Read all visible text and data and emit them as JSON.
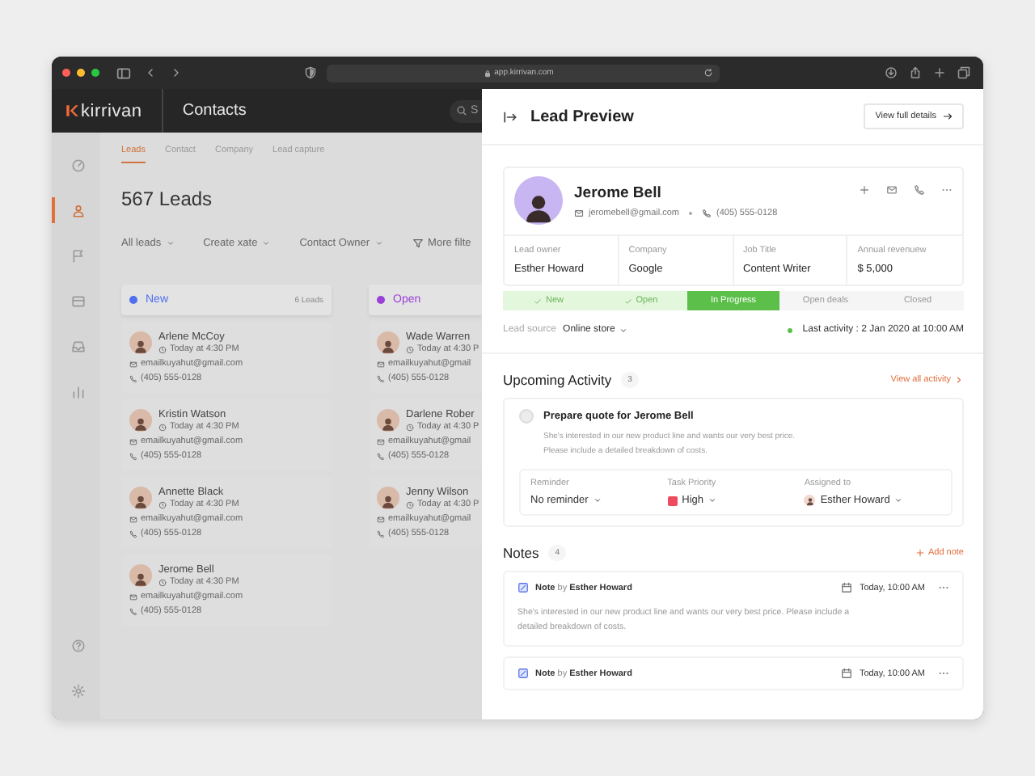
{
  "browser": {
    "url": "app.kirrivan.com"
  },
  "app_header": {
    "logo": "kirrivan",
    "section": "Contacts",
    "search_placeholder": "S"
  },
  "sidebar": {
    "items": [
      {
        "selected": false
      },
      {
        "selected": true
      },
      {
        "selected": false
      },
      {
        "selected": false
      },
      {
        "selected": false
      },
      {
        "selected": false
      }
    ],
    "bottom_items": [
      {
        "selected": false
      },
      {
        "selected": false
      }
    ]
  },
  "tabs": [
    {
      "label": "Leads",
      "selected": true
    },
    {
      "label": "Contact",
      "selected": false
    },
    {
      "label": "Company",
      "selected": false
    },
    {
      "label": "Lead capture",
      "selected": false
    }
  ],
  "heading": "567 Leads",
  "filters": [
    {
      "kind": "dropdown",
      "label": "All leads"
    },
    {
      "kind": "dropdown",
      "label": "Create xate"
    },
    {
      "kind": "dropdown",
      "label": "Contact Owner"
    },
    {
      "kind": "filter",
      "label": "More filte"
    }
  ],
  "columns": [
    {
      "title": "New",
      "color": "#4f6ef0",
      "count": "6 Leads",
      "cards": [
        {
          "name": "Arlene McCoy",
          "time": "Today at 4:30 PM",
          "email": "emailkuyahut@gmail.com",
          "phone": "(405) 555-0128"
        },
        {
          "name": "Kristin Watson",
          "time": "Today at 4:30 PM",
          "email": "emailkuyahut@gmail.com",
          "phone": "(405) 555-0128"
        },
        {
          "name": "Annette Black",
          "time": "Today at 4:30 PM",
          "email": "emailkuyahut@gmail.com",
          "phone": "(405) 555-0128"
        },
        {
          "name": "Jerome Bell",
          "time": "Today at 4:30 PM",
          "email": "emailkuyahut@gmail.com",
          "phone": "(405) 555-0128"
        }
      ]
    },
    {
      "title": "Open",
      "color": "#9a3fd8",
      "cards": [
        {
          "name": "Wade Warren",
          "time": "Today at 4:30 P",
          "email": "emailkuyahut@gmail",
          "phone": "(405) 555-0128"
        },
        {
          "name": "Darlene Rober",
          "time": "Today at 4:30 P",
          "email": "emailkuyahut@gmail",
          "phone": "(405) 555-0128"
        },
        {
          "name": "Jenny Wilson",
          "time": "Today at 4:30 P",
          "email": "emailkuyahut@gmail",
          "phone": "(405) 555-0128"
        }
      ]
    }
  ],
  "lead_preview": {
    "title": "Lead Preview",
    "details_button": "View full details",
    "lead": {
      "name": "Jerome Bell",
      "email": "jeromebell@gmail.com",
      "phone": "(405) 555-0128"
    },
    "info": [
      {
        "label": "Lead owner",
        "value": "Esther Howard"
      },
      {
        "label": "Company",
        "value": "Google"
      },
      {
        "label": "Job Title",
        "value": "Content Writer"
      },
      {
        "label": "Annual revenuew",
        "value": "$ 5,000"
      }
    ],
    "stages": [
      {
        "label": "New",
        "completed": true,
        "selected": false
      },
      {
        "label": "Open",
        "completed": true,
        "selected": false
      },
      {
        "label": "In Progress",
        "completed": false,
        "selected": true
      },
      {
        "label": "Open deals",
        "completed": false,
        "selected": false
      },
      {
        "label": "Closed",
        "completed": false,
        "selected": false
      }
    ],
    "lead_source": {
      "label": "Lead source",
      "value": "Online store"
    },
    "last_activity": "Last activity : 2 Jan 2020 at 10:00 AM",
    "upcoming": {
      "title": "Upcoming Activity",
      "count": "3",
      "link": "View all activity",
      "activity": {
        "title": "Prepare quote for Jerome Bell",
        "checked": false,
        "description": "She's interested in our new product line and wants our very best price.\nPlease include a detailed breakdown of costs.",
        "fields": [
          {
            "kind": "plain",
            "label": "Reminder",
            "value": "No reminder"
          },
          {
            "kind": "priority",
            "label": "Task Priority",
            "value": "High",
            "color": "#ee4b5f"
          },
          {
            "kind": "person",
            "label": "Assigned to",
            "value": "Esther Howard"
          }
        ]
      }
    },
    "notes": {
      "title": "Notes",
      "count": "4",
      "add": "Add note",
      "items": [
        {
          "author": "**Note** by **Esther Howard**",
          "date": "Today, 10:00 AM",
          "body": "She's interested in our new product line and wants our very best price. Please include a detailed breakdown of costs."
        },
        {
          "author": "**Note** by **Esther Howard**",
          "date": "Today, 10:00 AM"
        }
      ]
    }
  }
}
